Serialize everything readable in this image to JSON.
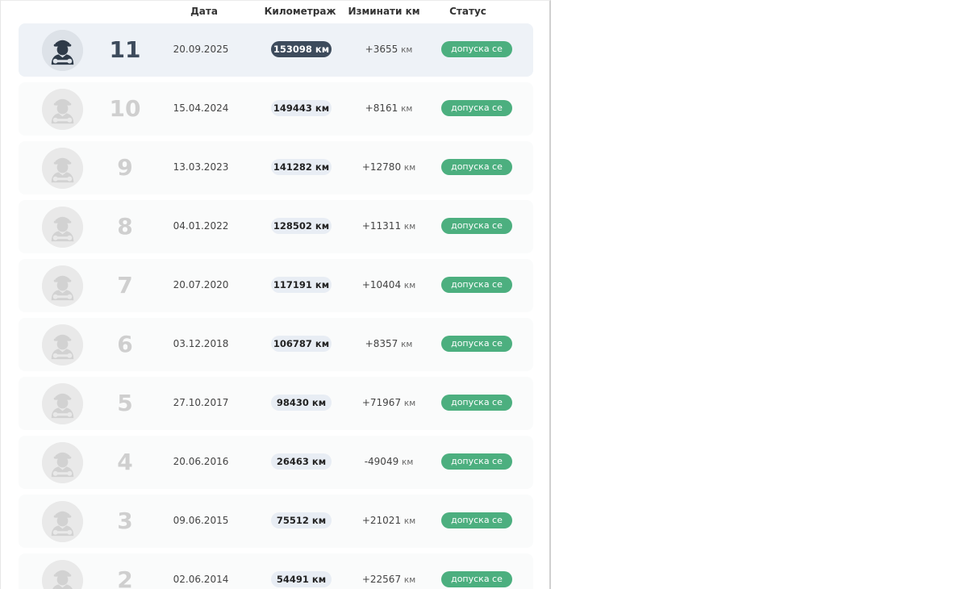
{
  "headers": {
    "date": "Дата",
    "km": "Километраж",
    "delta": "Изминати км",
    "status": "Статус"
  },
  "unit": "км",
  "colors": {
    "accent": "#3d4b5c",
    "status_ok": "#4caf7f",
    "pill_bg": "#e8edf4"
  },
  "rows": [
    {
      "number": "11",
      "date": "20.09.2025",
      "km": "153098 км",
      "delta": "+3655",
      "status": "допуска се",
      "current": true
    },
    {
      "number": "10",
      "date": "15.04.2024",
      "km": "149443 км",
      "delta": "+8161",
      "status": "допуска се",
      "current": false
    },
    {
      "number": "9",
      "date": "13.03.2023",
      "km": "141282 км",
      "delta": "+12780",
      "status": "допуска се",
      "current": false
    },
    {
      "number": "8",
      "date": "04.01.2022",
      "km": "128502 км",
      "delta": "+11311",
      "status": "допуска се",
      "current": false
    },
    {
      "number": "7",
      "date": "20.07.2020",
      "km": "117191 км",
      "delta": "+10404",
      "status": "допуска се",
      "current": false
    },
    {
      "number": "6",
      "date": "03.12.2018",
      "km": "106787 км",
      "delta": "+8357",
      "status": "допуска се",
      "current": false
    },
    {
      "number": "5",
      "date": "27.10.2017",
      "km": "98430 км",
      "delta": "+71967",
      "status": "допуска се",
      "current": false
    },
    {
      "number": "4",
      "date": "20.06.2016",
      "km": "26463 км",
      "delta": "-49049",
      "status": "допуска се",
      "current": false
    },
    {
      "number": "3",
      "date": "09.06.2015",
      "km": "75512 км",
      "delta": "+21021",
      "status": "допуска се",
      "current": false
    },
    {
      "number": "2",
      "date": "02.06.2014",
      "km": "54491 км",
      "delta": "+22567",
      "status": "допуска се",
      "current": false
    }
  ]
}
